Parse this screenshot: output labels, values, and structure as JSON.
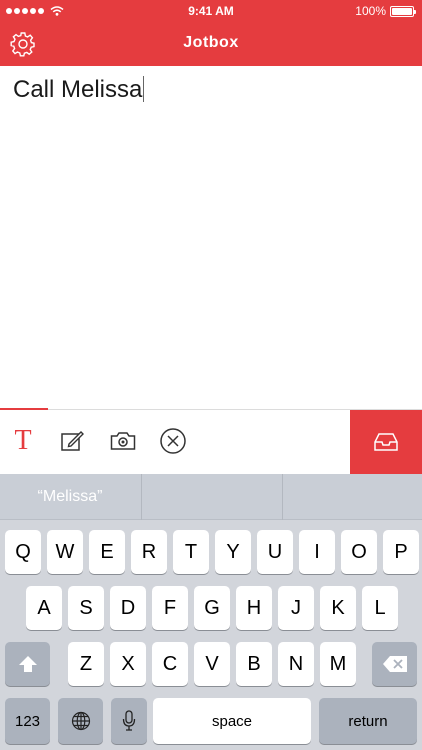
{
  "status_bar": {
    "time": "9:41 AM",
    "battery": "100%"
  },
  "nav": {
    "title": "Jotbox"
  },
  "note": {
    "text": "Call Melissa"
  },
  "colors": {
    "accent": "#e53c3f",
    "keyboard_bg": "#d2d5db",
    "key_dark": "#abb2bd"
  },
  "toolbar": {
    "text_tool_label": "T",
    "icons": [
      "text-format-icon",
      "edit-note-icon",
      "camera-icon",
      "clear-icon",
      "inbox-icon"
    ]
  },
  "keyboard": {
    "suggestions": [
      "“Melissa”",
      "",
      ""
    ],
    "row1": [
      "Q",
      "W",
      "E",
      "R",
      "T",
      "Y",
      "U",
      "I",
      "O",
      "P"
    ],
    "row2": [
      "A",
      "S",
      "D",
      "F",
      "G",
      "H",
      "J",
      "K",
      "L"
    ],
    "row3": [
      "Z",
      "X",
      "C",
      "V",
      "B",
      "N",
      "M"
    ],
    "numbers_label": "123",
    "space_label": "space",
    "return_label": "return"
  }
}
